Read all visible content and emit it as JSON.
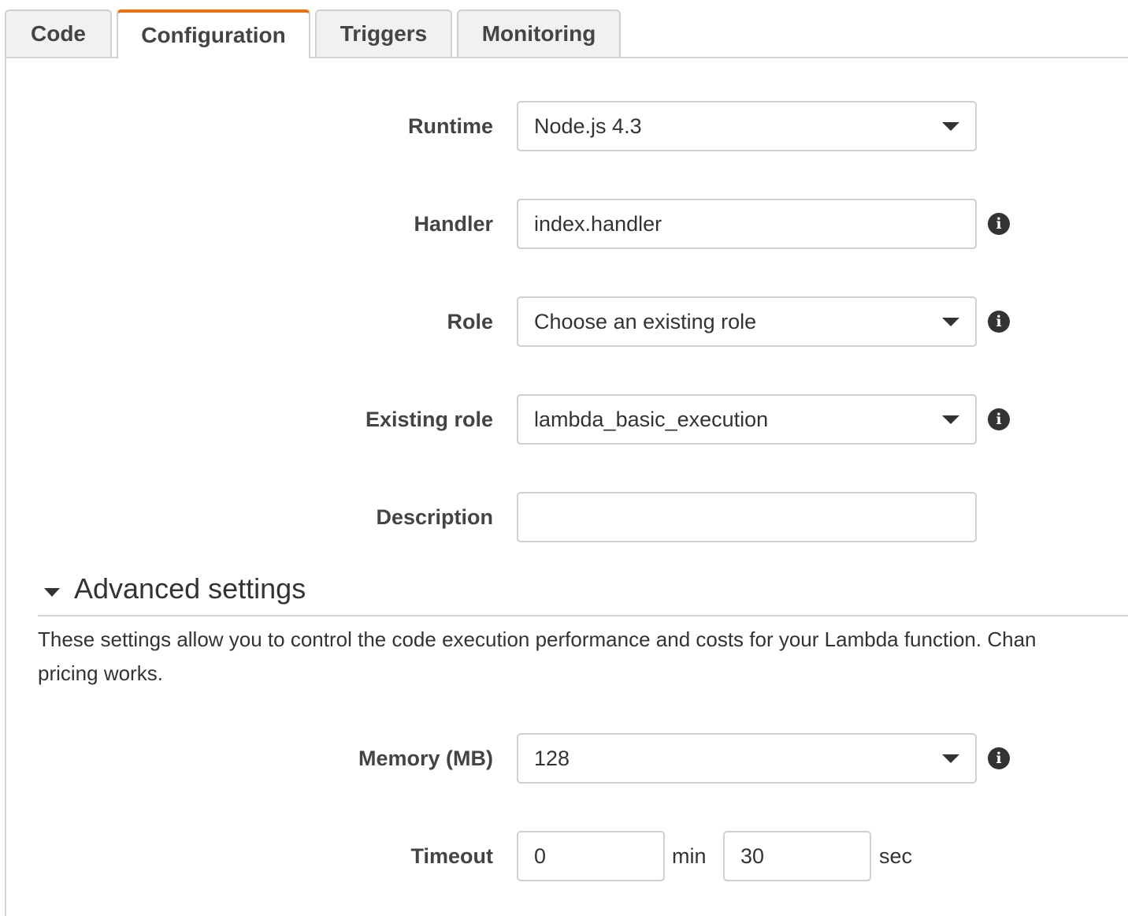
{
  "tabs": [
    {
      "label": "Code",
      "active": false
    },
    {
      "label": "Configuration",
      "active": true
    },
    {
      "label": "Triggers",
      "active": false
    },
    {
      "label": "Monitoring",
      "active": false
    }
  ],
  "form": {
    "runtime": {
      "label": "Runtime",
      "value": "Node.js 4.3"
    },
    "handler": {
      "label": "Handler",
      "value": "index.handler"
    },
    "role": {
      "label": "Role",
      "value": "Choose an existing role"
    },
    "existing_role": {
      "label": "Existing role",
      "value": "lambda_basic_execution"
    },
    "description": {
      "label": "Description",
      "value": ""
    }
  },
  "advanced": {
    "title": "Advanced settings",
    "description_line1": "These settings allow you to control the code execution performance and costs for your Lambda function. Chan",
    "description_line2": "pricing works.",
    "memory": {
      "label": "Memory (MB)",
      "value": "128"
    },
    "timeout": {
      "label": "Timeout",
      "minutes": "0",
      "minutes_unit": "min",
      "seconds": "30",
      "seconds_unit": "sec"
    }
  },
  "icons": {
    "info": "info-icon",
    "dropdown": "chevron-down-icon",
    "collapse": "caret-down-icon"
  },
  "colors": {
    "active_tab_accent": "#ec7211",
    "text": "#333333",
    "border": "#cfcfcf"
  }
}
